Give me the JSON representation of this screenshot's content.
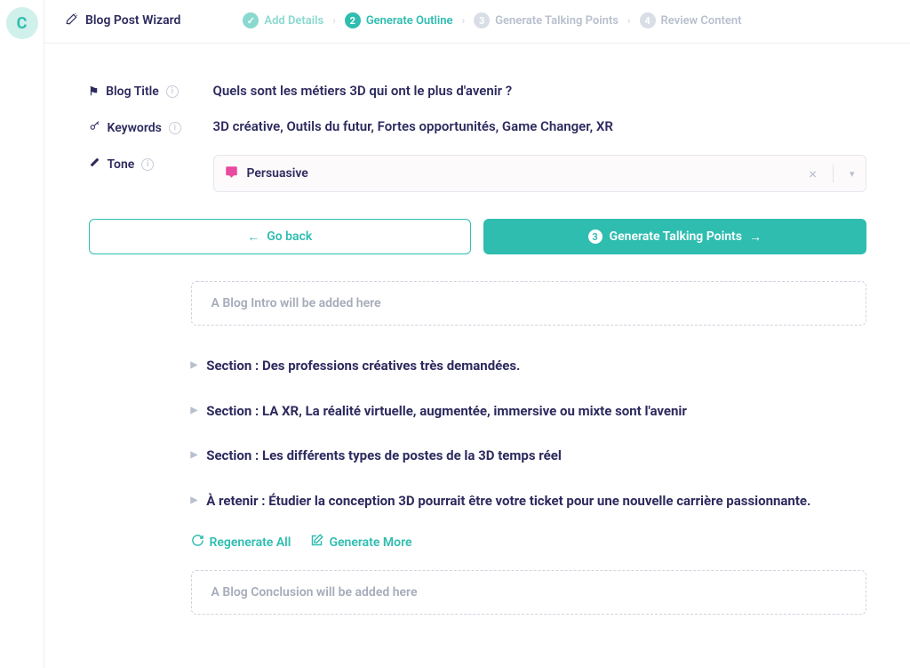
{
  "app": {
    "logo_letter": "C",
    "wizard_title": "Blog Post Wizard"
  },
  "steps": {
    "0": {
      "label": "Add Details",
      "badge": "✓"
    },
    "1": {
      "label": "Generate Outline",
      "badge": "2"
    },
    "2": {
      "label": "Generate Talking Points",
      "badge": "3"
    },
    "3": {
      "label": "Review Content",
      "badge": "4"
    }
  },
  "fields": {
    "blog_title": {
      "label": "Blog Title",
      "value": "Quels sont les métiers 3D qui ont le plus d'avenir ?"
    },
    "keywords": {
      "label": "Keywords",
      "value": "3D créative, Outils du futur, Fortes opportunités, Game Changer, XR"
    },
    "tone": {
      "label": "Tone",
      "value": "Persuasive"
    }
  },
  "buttons": {
    "back": "Go back",
    "next": "Generate Talking Points",
    "next_badge": "3"
  },
  "outline": {
    "intro_placeholder": "A Blog Intro will be added here",
    "sections": {
      "0": "Section : Des professions créatives très demandées.",
      "1": "Section : LA XR, La réalité virtuelle, augmentée, immersive ou mixte sont l'avenir",
      "2": "Section : Les différents types de postes de la 3D temps réel",
      "3": "À retenir : Étudier la conception 3D pourrait être votre ticket pour une nouvelle carrière passionnante."
    },
    "regenerate_all": "Regenerate All",
    "generate_more": "Generate More",
    "conclusion_placeholder": "A Blog Conclusion will be added here"
  }
}
